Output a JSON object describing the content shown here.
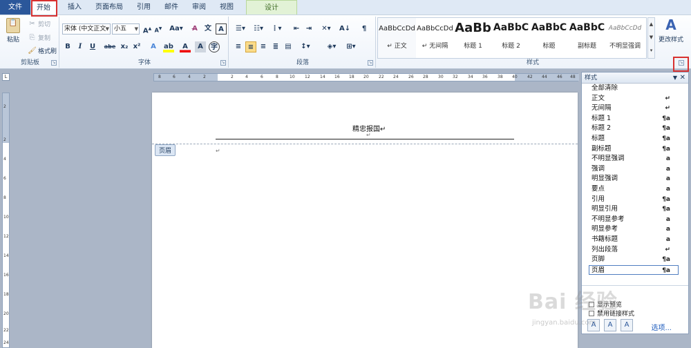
{
  "tabs": [
    "文件",
    "开始",
    "插入",
    "页面布局",
    "引用",
    "邮件",
    "审阅",
    "视图",
    "设计"
  ],
  "clipboard": {
    "paste": "粘贴",
    "cut": "剪切",
    "copy": "复制",
    "format_painter": "格式刷",
    "group_label": "剪贴板"
  },
  "font": {
    "font_name": "宋体 (中文正文)",
    "font_size": "小五",
    "group_label": "字体"
  },
  "paragraph": {
    "group_label": "段落"
  },
  "styles_group": {
    "group_label": "样式",
    "change_styles": "更改样式",
    "gallery": [
      {
        "sample": "AaBbCcDd",
        "name": "↵ 正文"
      },
      {
        "sample": "AaBbCcDd",
        "name": "↵ 无间隔"
      },
      {
        "sample": "AaBb",
        "name": "标题 1"
      },
      {
        "sample": "AaBbC",
        "name": "标题 2"
      },
      {
        "sample": "AaBbC",
        "name": "标题"
      },
      {
        "sample": "AaBbC",
        "name": "副标题"
      },
      {
        "sample": "AaBbCcDd",
        "name": "不明显强调"
      }
    ]
  },
  "ruler": {
    "h_ticks": [
      "8",
      "6",
      "4",
      "2",
      "2",
      "4",
      "6",
      "8",
      "10",
      "12",
      "14",
      "16",
      "18",
      "20",
      "22",
      "24",
      "26",
      "28",
      "30",
      "32",
      "34",
      "36",
      "38",
      "40",
      "42",
      "44",
      "46",
      "48"
    ],
    "v_ticks": [
      "2",
      "2",
      "4",
      "6",
      "8",
      "10",
      "12",
      "14",
      "16",
      "18",
      "20",
      "22",
      "24"
    ]
  },
  "document": {
    "header_text": "精忠报国↵",
    "header_label": "页眉",
    "para_mark": "↵"
  },
  "styles_pane": {
    "title": "样式",
    "items": [
      {
        "name": "全部清除",
        "kind": ""
      },
      {
        "name": "正文",
        "kind": "↵"
      },
      {
        "name": "无间隔",
        "kind": "↵"
      },
      {
        "name": "标题 1",
        "kind": "¶a"
      },
      {
        "name": "标题 2",
        "kind": "¶a"
      },
      {
        "name": "标题",
        "kind": "¶a"
      },
      {
        "name": "副标题",
        "kind": "¶a"
      },
      {
        "name": "不明显强调",
        "kind": "a"
      },
      {
        "name": "强调",
        "kind": "a"
      },
      {
        "name": "明显强调",
        "kind": "a"
      },
      {
        "name": "要点",
        "kind": "a"
      },
      {
        "name": "引用",
        "kind": "¶a"
      },
      {
        "name": "明显引用",
        "kind": "¶a"
      },
      {
        "name": "不明显参考",
        "kind": "a"
      },
      {
        "name": "明显参考",
        "kind": "a"
      },
      {
        "name": "书籍标题",
        "kind": "a"
      },
      {
        "name": "列出段落",
        "kind": "↵"
      },
      {
        "name": "页脚",
        "kind": "¶a"
      },
      {
        "name": "页眉",
        "kind": "¶a"
      }
    ],
    "show_preview": "显示预览",
    "disable_linked": "禁用链接样式",
    "options": "选项..."
  },
  "watermark": {
    "brand": "Bai 经验",
    "url": "jingyan.baidu.com"
  }
}
